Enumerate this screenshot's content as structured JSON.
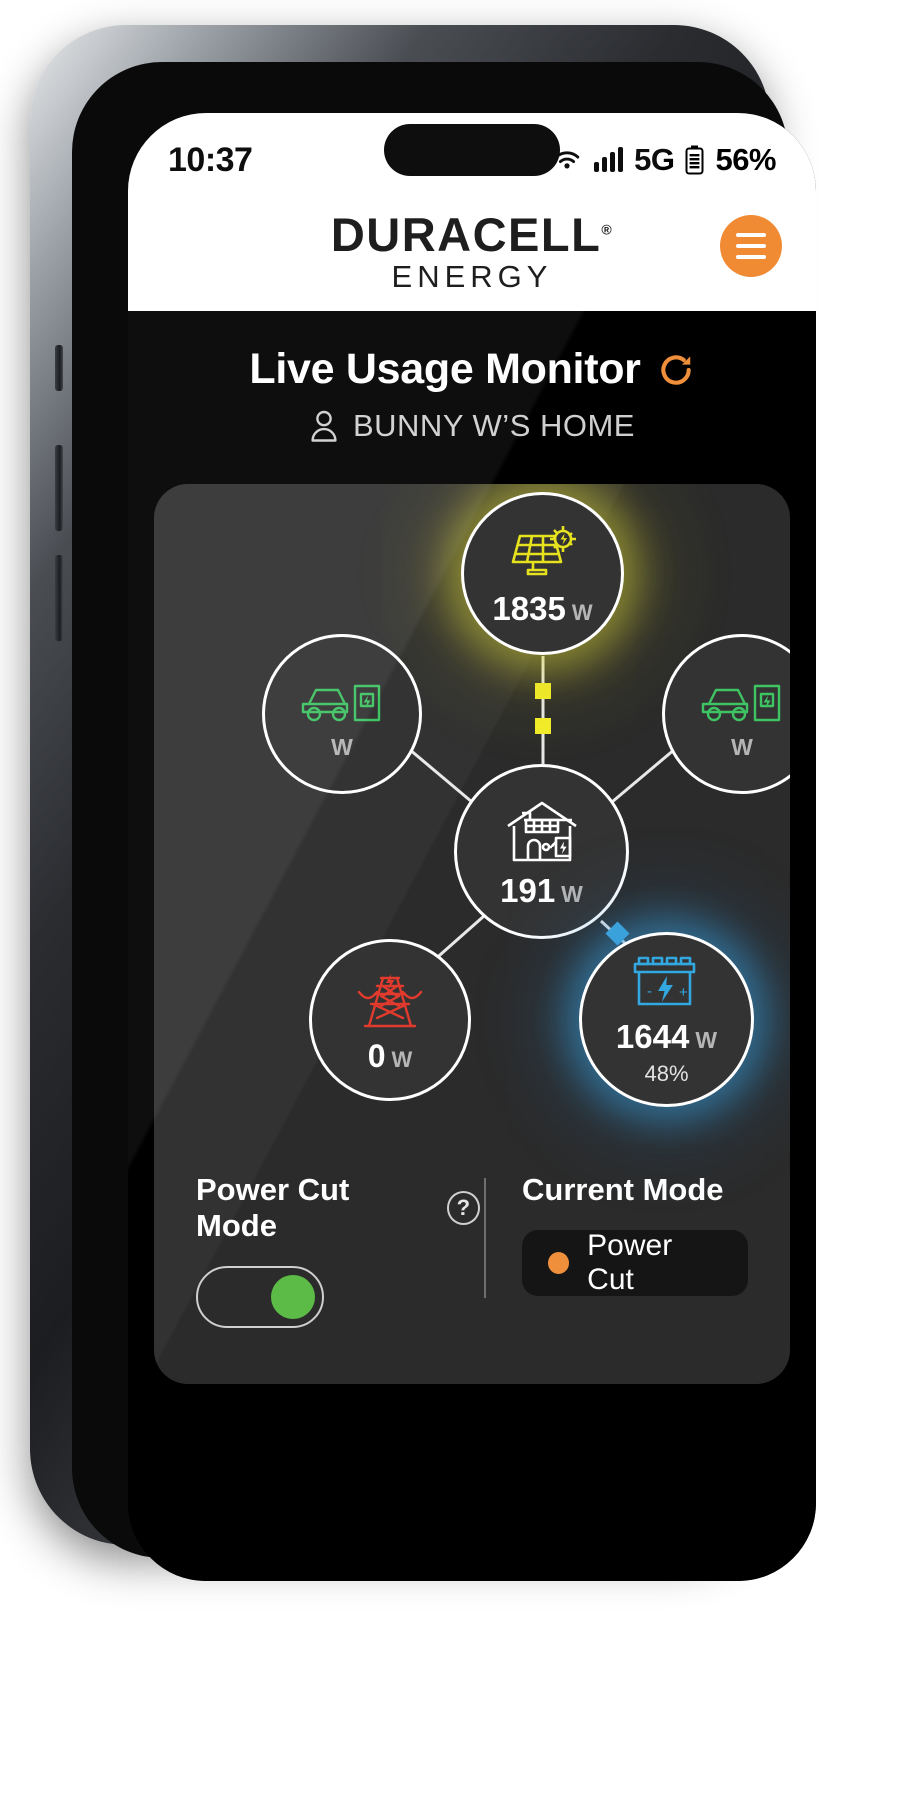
{
  "status_bar": {
    "time": "10:37",
    "wifi_icon": "wifi-icon",
    "signal_icon": "cellular-bars-icon",
    "network": "5G",
    "battery_icon": "battery-icon",
    "battery_percent": "56%"
  },
  "brand": {
    "wordmark": "DURACELL",
    "registered": "®",
    "sub": "ENERGY",
    "menu_icon": "hamburger-menu-icon"
  },
  "header": {
    "title": "Live Usage Monitor",
    "refresh_icon": "refresh-icon",
    "user_icon": "user-icon",
    "home_name": "BUNNY W’S HOME"
  },
  "nodes": {
    "solar": {
      "name": "Solar",
      "icon": "solar-panel-icon",
      "value": "1835",
      "unit": "W",
      "color": "#e6e21e"
    },
    "ev_left": {
      "name": "EV Charger 1",
      "icon": "ev-charger-icon",
      "value": "",
      "unit": "W",
      "color": "#3fc463"
    },
    "ev_right": {
      "name": "EV Charger 2",
      "icon": "ev-charger-icon",
      "value": "",
      "unit": "W",
      "color": "#3fc463"
    },
    "home": {
      "name": "Home",
      "icon": "home-icon",
      "value": "191",
      "unit": "W",
      "color": "#ffffff"
    },
    "grid": {
      "name": "Grid",
      "icon": "pylon-icon",
      "value": "0",
      "unit": "W",
      "color": "#e23b2e"
    },
    "battery": {
      "name": "Battery",
      "icon": "battery-cell-icon",
      "value": "1644",
      "unit": "W",
      "sub": "48%",
      "color": "#33a7e0"
    }
  },
  "flows": {
    "solar_to_home": {
      "color": "#f2ec2a",
      "direction": "down"
    },
    "home_to_battery": {
      "color": "#41a8df",
      "direction": "down-right"
    }
  },
  "controls": {
    "power_cut_label": "Power Cut Mode",
    "help_glyph": "?",
    "toggle_state": "on",
    "toggle_on_color": "#5cbb46",
    "current_mode_label": "Current Mode",
    "current_mode_value": "Power Cut",
    "current_mode_dot_color": "#ef8f3c"
  }
}
